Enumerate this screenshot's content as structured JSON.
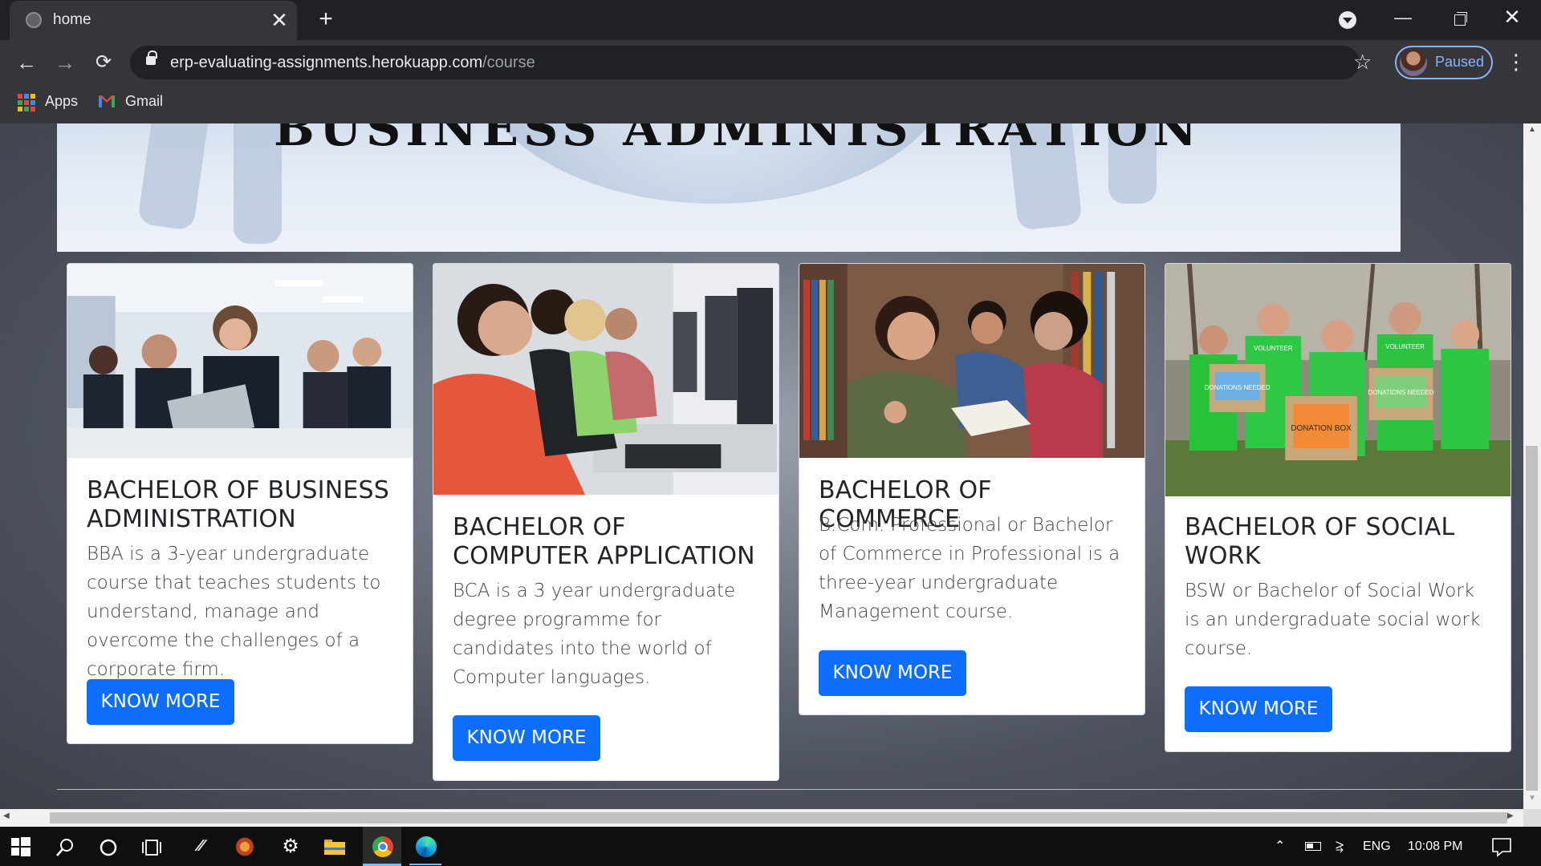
{
  "browser": {
    "tab_title": "home",
    "tab_close": "✕",
    "new_tab": "+",
    "url_host": "erp-evaluating-assignments.herokuapp.com",
    "url_path": "/course",
    "profile_status": "Paused",
    "bookmarks": [
      {
        "label": "Apps",
        "icon": "apps-grid-icon"
      },
      {
        "label": "Gmail",
        "icon": "gmail-icon"
      }
    ]
  },
  "hero": {
    "title_fragment": "BUSINESS ADMINISTRATION"
  },
  "courses": [
    {
      "title": "BACHELOR OF BUSINESS ADMINISTRATION",
      "description": "BBA is a 3-year undergraduate course that teaches students to understand, manage and overcome the challenges of a corporate firm.",
      "button": "KNOW MORE"
    },
    {
      "title": "BACHELOR OF COMPUTER APPLICATION",
      "description": "BCA is a 3 year undergraduate degree programme for candidates into the world of Computer languages.",
      "button": "KNOW MORE"
    },
    {
      "title": "BACHELOR OF COMMERCE",
      "description": "B.Com. Professional or Bachelor of Commerce in Professional is a three-year undergraduate Management course.",
      "button": "KNOW MORE"
    },
    {
      "title": "BACHELOR OF SOCIAL WORK",
      "description": "BSW or Bachelor of Social Work is an undergraduate social work course.",
      "button": "KNOW MORE",
      "image_box_labels": [
        "VOLUNTEER",
        "DONATIONS NEEDED",
        "DONATION BOX",
        "DONATIONS NEEDED",
        "VOLUNTEER"
      ]
    }
  ],
  "taskbar": {
    "language": "ENG",
    "time": "10:08 PM"
  },
  "colors": {
    "button_primary": "#0d6efd",
    "chrome_dark": "#202124",
    "chrome_toolbar": "#35363a",
    "profile_accent": "#8ab4f8"
  }
}
